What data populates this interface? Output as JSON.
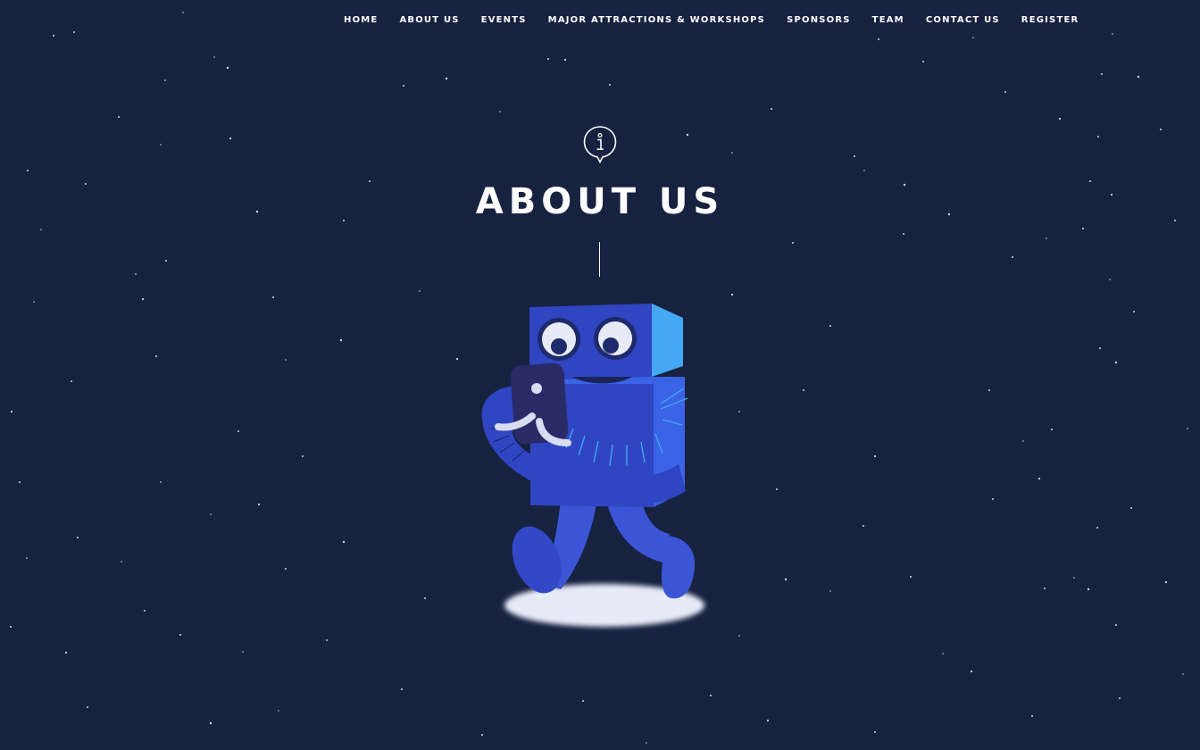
{
  "nav": {
    "items": [
      {
        "label": "HOME"
      },
      {
        "label": "ABOUT US"
      },
      {
        "label": "EVENTS"
      },
      {
        "label": "MAJOR ATTRACTIONS & WORKSHOPS"
      },
      {
        "label": "SPONSORS"
      },
      {
        "label": "TEAM"
      },
      {
        "label": "CONTACT US"
      },
      {
        "label": "REGISTER"
      }
    ]
  },
  "section": {
    "icon": "info-pin-icon",
    "title": "ABOUT US"
  },
  "colors": {
    "background": "#172241",
    "text": "#ffffff",
    "robot_blue": "#2f45c2",
    "robot_light": "#45a8f5"
  }
}
